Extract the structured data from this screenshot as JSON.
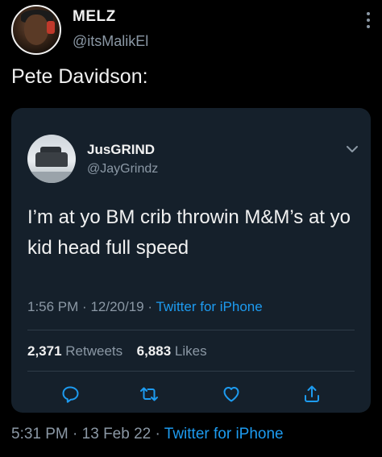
{
  "author": {
    "display_name": "MELZ",
    "handle": "@itsMalikEl",
    "avatar_icon": "profile-photo"
  },
  "tweet": {
    "text": "Pete Davidson:"
  },
  "quoted_tweet": {
    "display_name": "JusGRIND",
    "handle": "@JayGrindz",
    "text": "I’m at yo BM crib throwin M&M’s at yo kid head full speed",
    "time": "1:56 PM",
    "date": "12/20/19",
    "source": "Twitter for iPhone",
    "retweets": {
      "count": "2,371",
      "label": "Retweets"
    },
    "likes": {
      "count": "6,883",
      "label": "Likes"
    },
    "actions": [
      "reply-icon",
      "retweet-icon",
      "like-icon",
      "share-icon"
    ]
  },
  "footer": {
    "time": "5:31 PM",
    "date": "13 Feb 22",
    "source": "Twitter for iPhone"
  },
  "colors": {
    "background": "#000000",
    "card": "#15202b",
    "link": "#1d9bf0",
    "muted": "#8b98a5",
    "text": "#f1f1f1"
  }
}
